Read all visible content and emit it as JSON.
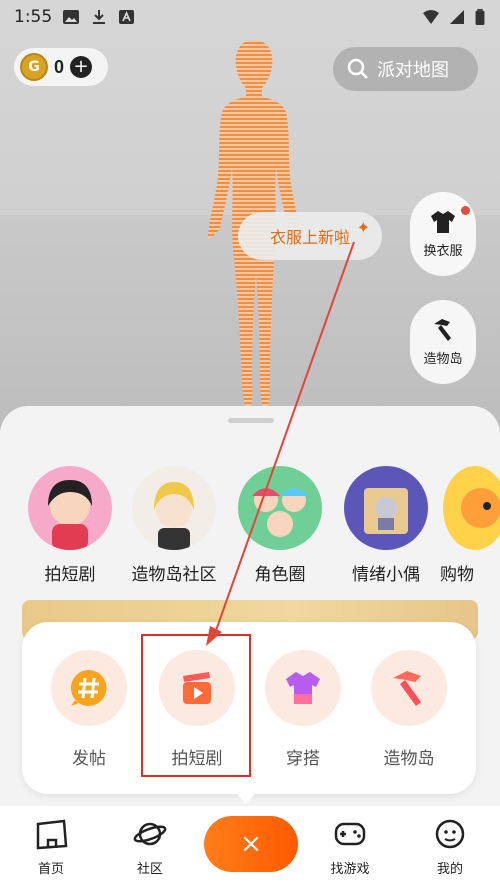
{
  "status": {
    "time": "1:55"
  },
  "wallet": {
    "coins": "0",
    "add": "+"
  },
  "search": {
    "label": "派对地图"
  },
  "bubble": {
    "text": "衣服上新啦",
    "star": "✦"
  },
  "side": [
    {
      "label": "换衣服",
      "icon": "tshirt-icon"
    },
    {
      "label": "造物岛",
      "icon": "hammer-icon"
    }
  ],
  "categories": [
    {
      "label": "拍短剧"
    },
    {
      "label": "造物岛社区"
    },
    {
      "label": "角色圈"
    },
    {
      "label": "情绪小偶"
    },
    {
      "label": "购物"
    }
  ],
  "popup": {
    "items": [
      {
        "label": "发帖",
        "icon": "hashtag-chat-icon"
      },
      {
        "label": "拍短剧",
        "icon": "clapperboard-play-icon"
      },
      {
        "label": "穿搭",
        "icon": "tshirt-icon"
      },
      {
        "label": "造物岛",
        "icon": "hammer-icon"
      }
    ]
  },
  "nav": {
    "items": [
      {
        "label": "首页",
        "icon": "home-icon"
      },
      {
        "label": "社区",
        "icon": "planet-icon"
      },
      {
        "label": "找游戏",
        "icon": "gamepad-icon"
      },
      {
        "label": "我的",
        "icon": "profile-icon"
      }
    ],
    "fab": "×"
  },
  "colors": {
    "accent": "#ff6a00",
    "highlight": "#d9302a"
  }
}
